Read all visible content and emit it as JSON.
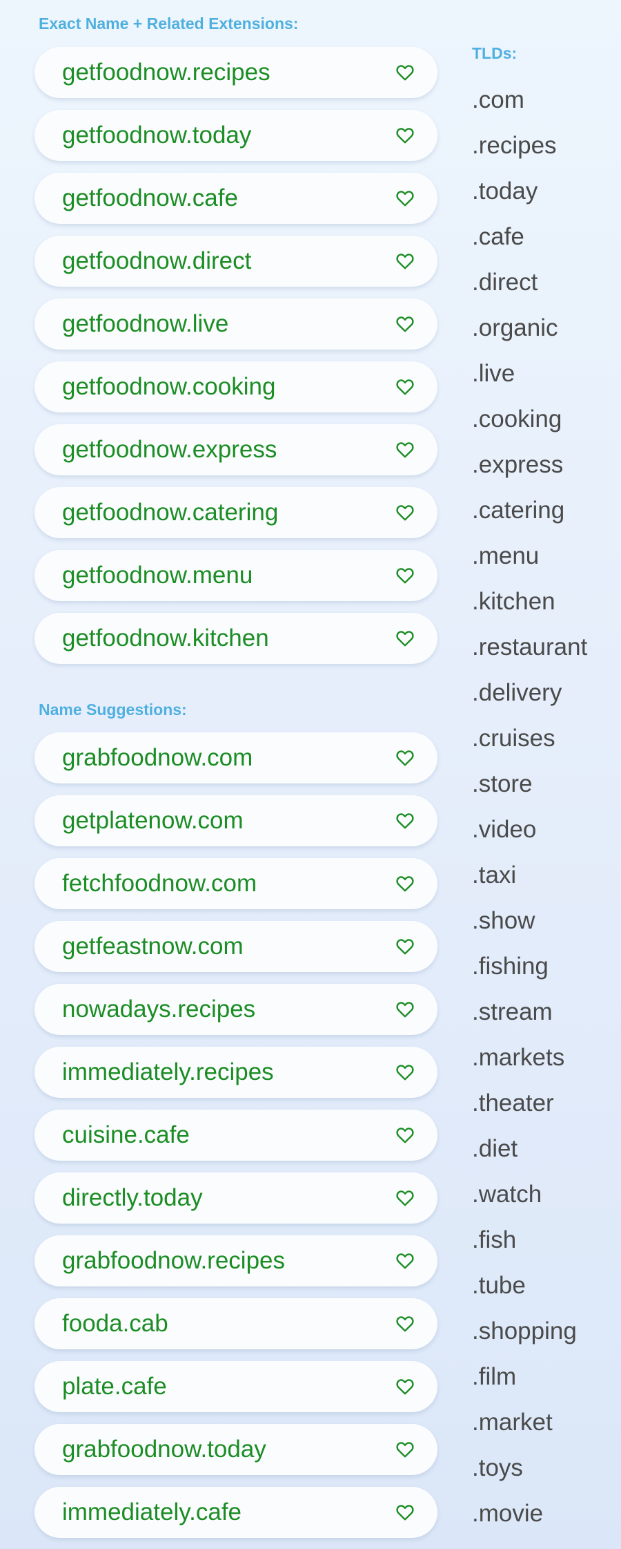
{
  "exact_section": {
    "heading": "Exact Name + Related Extensions:",
    "domains": [
      "getfoodnow.recipes",
      "getfoodnow.today",
      "getfoodnow.cafe",
      "getfoodnow.direct",
      "getfoodnow.live",
      "getfoodnow.cooking",
      "getfoodnow.express",
      "getfoodnow.catering",
      "getfoodnow.menu",
      "getfoodnow.kitchen"
    ]
  },
  "suggestions_section": {
    "heading": "Name Suggestions:",
    "domains": [
      "grabfoodnow.com",
      "getplatenow.com",
      "fetchfoodnow.com",
      "getfeastnow.com",
      "nowadays.recipes",
      "immediately.recipes",
      "cuisine.cafe",
      "directly.today",
      "grabfoodnow.recipes",
      "fooda.cab",
      "plate.cafe",
      "grabfoodnow.today",
      "immediately.cafe"
    ]
  },
  "tlds": {
    "heading": "TLDs:",
    "items": [
      ".com",
      ".recipes",
      ".today",
      ".cafe",
      ".direct",
      ".organic",
      ".live",
      ".cooking",
      ".express",
      ".catering",
      ".menu",
      ".kitchen",
      ".restaurant",
      ".delivery",
      ".cruises",
      ".store",
      ".video",
      ".taxi",
      ".show",
      ".fishing",
      ".stream",
      ".markets",
      ".theater",
      ".diet",
      ".watch",
      ".fish",
      ".tube",
      ".shopping",
      ".film",
      ".market",
      ".toys",
      ".movie"
    ]
  },
  "icons": {
    "favorite": "heart-outline-icon"
  },
  "colors": {
    "heading": "#4fb0e0",
    "domain_text": "#1b8d24",
    "tld_text": "#4a4a4a",
    "heart": "#1b8d24"
  }
}
